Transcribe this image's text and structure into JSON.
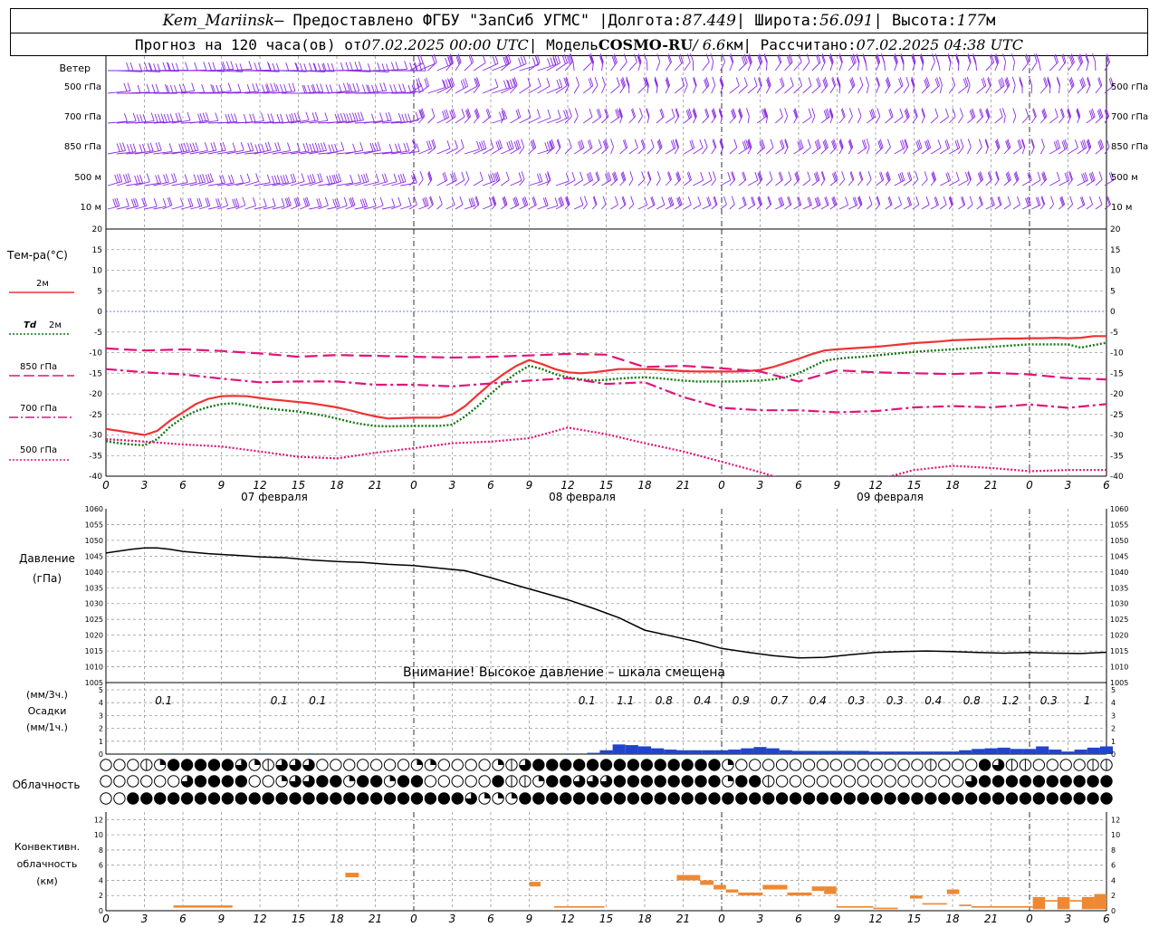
{
  "header": {
    "station": "Kem_Mariinsk",
    "provided_by": " — Предоставлено ФГБУ \"ЗапСиб УГМС\" | ",
    "lon_label": "Долгота: ",
    "lon": "87.449",
    "lat_label": " | Широта: ",
    "lat": "56.091",
    "alt_label": " | Высота: ",
    "alt": "177",
    "alt_unit": "м",
    "forecast_prefix": "Прогноз на 120 часа(ов) от ",
    "forecast_start": "07.02.2025 00:00 UTC",
    "model_label": " | Модель ",
    "model": "COSMO-RU",
    "model_res": " / 6.6",
    "model_res_unit": "км",
    "calc_label": " | Рассчитано: ",
    "calc_time": "07.02.2025 04:38 UTC"
  },
  "labels": {
    "wind": "Ветер",
    "level_500hpa": "500 гПа",
    "level_700hpa": "700 гПа",
    "level_850hpa": "850 гПа",
    "level_500m": "500 м",
    "level_10m": "10 м",
    "temp_title": "Тем-ра(°С)",
    "legend_2m": "2м",
    "legend_td": "Td",
    "legend_td_2m": "2м",
    "legend_850": "850 гПа",
    "legend_700": "700 гПа",
    "legend_500": "500 гПа",
    "pressure_title": "Давление",
    "pressure_unit": "(гПа)",
    "pressure_warning": "Внимание! Высокое давление – шкала смещена",
    "precip_unit3": "(мм/3ч.)",
    "precip_title": "Осадки",
    "precip_unit1": "(мм/1ч.)",
    "cloud_title": "Облачность",
    "conv_title1": "Конвективн.",
    "conv_title2": "облачность",
    "conv_unit": "(км)"
  },
  "colors": {
    "wind": "#8a2be2",
    "t2m": "#ee3333",
    "td2m": "#117711",
    "levels": "#e0157a",
    "zero_line": "#3355ff",
    "precip": "#2244cc",
    "conv": "#ee8833",
    "grid": "#999999"
  },
  "chart_data": [
    {
      "type": "line",
      "name": "temperature",
      "x_hours": [
        0,
        3,
        6,
        9,
        12,
        15,
        18,
        21,
        24,
        27,
        30,
        33,
        36,
        39,
        42,
        45,
        48,
        51,
        54,
        57,
        60,
        63,
        66,
        69,
        72,
        75,
        78
      ],
      "x_tick_labels": [
        "0",
        "3",
        "6",
        "9",
        "12",
        "15",
        "18",
        "21",
        "0",
        "3",
        "6",
        "9",
        "12",
        "15",
        "18",
        "21",
        "0",
        "3",
        "6",
        "9",
        "12",
        "15",
        "18",
        "21",
        "0",
        "3",
        "6"
      ],
      "day_labels": [
        "07 февраля",
        "08 февраля",
        "09 февраля"
      ],
      "ylim": [
        -40,
        20
      ],
      "yticks": [
        20,
        15,
        10,
        5,
        0,
        -5,
        -10,
        -15,
        -20,
        -25,
        -30,
        -35,
        -40
      ],
      "series": [
        {
          "key": "t2m",
          "x": [
            0,
            2,
            3,
            4,
            5,
            6,
            7,
            8,
            9,
            10,
            11,
            12,
            13,
            14,
            15,
            16,
            17,
            18,
            19,
            20,
            21,
            22,
            24,
            26,
            27,
            28,
            29,
            30,
            31,
            32,
            33,
            34,
            35,
            36,
            37,
            38,
            39,
            40,
            41,
            42,
            43,
            44,
            45,
            46,
            47,
            48,
            49,
            50,
            51,
            52,
            53,
            54,
            55,
            56,
            57,
            58,
            59,
            60,
            61,
            62,
            63,
            64,
            65,
            66,
            67,
            68,
            69,
            70,
            71,
            72,
            73,
            74,
            75,
            76,
            77,
            78
          ],
          "y": [
            -28.5,
            -29.5,
            -30,
            -29,
            -26.5,
            -24.5,
            -22.5,
            -21.2,
            -20.6,
            -20.5,
            -20.6,
            -21,
            -21.4,
            -21.7,
            -22,
            -22.3,
            -22.8,
            -23.3,
            -24,
            -24.8,
            -25.5,
            -26,
            -25.8,
            -25.8,
            -25,
            -23,
            -20.2,
            -17.5,
            -15.2,
            -13.2,
            -11.8,
            -12.8,
            -14,
            -14.8,
            -15,
            -14.8,
            -14.4,
            -14,
            -14,
            -14,
            -14.1,
            -14.3,
            -14.5,
            -14.6,
            -14.6,
            -14.6,
            -14.6,
            -14.5,
            -14.2,
            -13.5,
            -12.5,
            -11.5,
            -10.4,
            -9.5,
            -9.2,
            -9,
            -8.8,
            -8.6,
            -8.3,
            -8,
            -7.7,
            -7.5,
            -7.3,
            -7,
            -6.9,
            -6.8,
            -6.7,
            -6.6,
            -6.6,
            -6.5,
            -6.5,
            -6.4,
            -6.5,
            -6.4,
            -6,
            -6
          ]
        },
        {
          "key": "td2m",
          "x": [
            0,
            1,
            2,
            3,
            4,
            5,
            6,
            7,
            8,
            9,
            10,
            11,
            12,
            13,
            14,
            15,
            16,
            17,
            18,
            19,
            20,
            21,
            22,
            24,
            26,
            27,
            28,
            29,
            30,
            31,
            32,
            33,
            34,
            35,
            36,
            37,
            38,
            39,
            40,
            41,
            42,
            43,
            44,
            45,
            46,
            47,
            48,
            49,
            50,
            51,
            52,
            53,
            54,
            55,
            56,
            57,
            58,
            59,
            60,
            61,
            62,
            63,
            64,
            65,
            66,
            67,
            68,
            69,
            70,
            71,
            72,
            73,
            74,
            75,
            76,
            77,
            78
          ],
          "y": [
            -31.5,
            -32,
            -32.3,
            -32.5,
            -31,
            -28,
            -25.8,
            -24.2,
            -23.2,
            -22.5,
            -22.3,
            -22.8,
            -23.3,
            -23.7,
            -24,
            -24.3,
            -24.8,
            -25.3,
            -26,
            -26.8,
            -27.4,
            -27.8,
            -27.9,
            -27.8,
            -27.8,
            -27.5,
            -25.5,
            -23,
            -20,
            -17.3,
            -15,
            -13.2,
            -14,
            -15.2,
            -16,
            -16.5,
            -16.8,
            -16.6,
            -16.3,
            -16.1,
            -16,
            -16.2,
            -16.5,
            -16.8,
            -17,
            -17,
            -17,
            -17,
            -16.9,
            -16.8,
            -16.5,
            -16,
            -15,
            -13.5,
            -12,
            -11.5,
            -11.2,
            -11,
            -10.7,
            -10.4,
            -10.1,
            -9.8,
            -9.6,
            -9.4,
            -9.2,
            -9,
            -8.8,
            -8.6,
            -8.4,
            -8.2,
            -8,
            -8,
            -8,
            -8,
            -8.8,
            -8.2,
            -7.6
          ]
        },
        {
          "key": "t850",
          "x": [
            0,
            3,
            6,
            9,
            12,
            15,
            18,
            21,
            24,
            27,
            30,
            33,
            36,
            39,
            42,
            45,
            48,
            51,
            54,
            57,
            60,
            63,
            66,
            69,
            72,
            75,
            78
          ],
          "y": [
            -9,
            -9.5,
            -9.2,
            -9.6,
            -10.2,
            -11,
            -10.6,
            -10.8,
            -11,
            -11.2,
            -11,
            -10.7,
            -10.3,
            -10.5,
            -13.5,
            -13.2,
            -13.8,
            -14.6,
            -17,
            -14.3,
            -14.8,
            -15,
            -15.2,
            -14.9,
            -15.3,
            -16.2,
            -16.5
          ]
        },
        {
          "key": "t700",
          "x": [
            0,
            3,
            6,
            9,
            12,
            15,
            18,
            21,
            24,
            27,
            30,
            33,
            36,
            39,
            42,
            45,
            48,
            51,
            54,
            57,
            60,
            63,
            66,
            69,
            72,
            75,
            78
          ],
          "y": [
            -14,
            -14.8,
            -15.3,
            -16.3,
            -17.2,
            -17,
            -17,
            -17.8,
            -17.8,
            -18.2,
            -17.5,
            -16.8,
            -16.2,
            -17.6,
            -17.2,
            -20.8,
            -23.4,
            -24,
            -24,
            -24.5,
            -24.2,
            -23.3,
            -23,
            -23.3,
            -22.6,
            -23.4,
            -22.5
          ]
        },
        {
          "key": "t500",
          "x": [
            0,
            3,
            6,
            9,
            12,
            15,
            18,
            21,
            24,
            27,
            30,
            33,
            36,
            39,
            42,
            45,
            48,
            51,
            54,
            57,
            60,
            63,
            66,
            69,
            72,
            75,
            78
          ],
          "y": [
            -31,
            -31.6,
            -32.3,
            -32.8,
            -34,
            -35.3,
            -35.7,
            -34.3,
            -33.2,
            -32,
            -31.6,
            -30.8,
            -28.2,
            -29.8,
            -32,
            -34,
            -36.5,
            -39,
            -42,
            -44,
            -41,
            -38.5,
            -37.5,
            -38,
            -38.8,
            -38.5,
            -38.5
          ]
        }
      ]
    },
    {
      "type": "line",
      "name": "pressure",
      "ylim": [
        1005,
        1060
      ],
      "yticks": [
        1060,
        1055,
        1050,
        1045,
        1040,
        1035,
        1030,
        1025,
        1020,
        1015,
        1010,
        1005
      ],
      "x": [
        0,
        2,
        3,
        4,
        5,
        6,
        8,
        10,
        12,
        14,
        16,
        18,
        20,
        22,
        24,
        26,
        28,
        30,
        32,
        34,
        36,
        38,
        40,
        42,
        44,
        46,
        48,
        50,
        52,
        54,
        56,
        58,
        60,
        62,
        64,
        66,
        68,
        70,
        72,
        74,
        76,
        78
      ],
      "y": [
        1046,
        1047.2,
        1047.6,
        1047.6,
        1047.2,
        1046.5,
        1045.8,
        1045.3,
        1044.8,
        1044.5,
        1043.8,
        1043.3,
        1043,
        1042.4,
        1042,
        1041.2,
        1040.4,
        1038.2,
        1035.8,
        1033.5,
        1031.2,
        1028.5,
        1025.5,
        1021.6,
        1019.8,
        1018,
        1015.8,
        1014.6,
        1013.5,
        1012.8,
        1013,
        1013.8,
        1014.5,
        1014.8,
        1015,
        1014.8,
        1014.5,
        1014.3,
        1014.5,
        1014.3,
        1014.2,
        1014.6
      ]
    },
    {
      "type": "bar",
      "name": "precipitation",
      "ylim": [
        0,
        5
      ],
      "yticks": [
        5,
        4,
        3,
        2,
        1,
        0
      ],
      "hourly_x": [
        5,
        12,
        16,
        36,
        38,
        39,
        40,
        41,
        42,
        43,
        44,
        45,
        46,
        47,
        48,
        49,
        50,
        51,
        52,
        53,
        54,
        55,
        56,
        57,
        58,
        59,
        60,
        61,
        62,
        63,
        64,
        65,
        66,
        67,
        68,
        69,
        70,
        71,
        72,
        73,
        74,
        75,
        76,
        77,
        78
      ],
      "hourly_mm": [
        0.05,
        0.05,
        0.05,
        0.05,
        0.1,
        0.3,
        0.75,
        0.7,
        0.6,
        0.45,
        0.35,
        0.3,
        0.3,
        0.3,
        0.3,
        0.35,
        0.45,
        0.55,
        0.45,
        0.3,
        0.25,
        0.25,
        0.25,
        0.25,
        0.25,
        0.25,
        0.2,
        0.2,
        0.2,
        0.2,
        0.2,
        0.2,
        0.2,
        0.3,
        0.4,
        0.45,
        0.5,
        0.4,
        0.4,
        0.6,
        0.35,
        0.2,
        0.35,
        0.5,
        0.6
      ],
      "accum3h_x": [
        4.5,
        13.5,
        16.5,
        37.5,
        40.5,
        43.5,
        46.5,
        49.5,
        52.5,
        55.5,
        58.5,
        61.5,
        64.5,
        67.5,
        70.5,
        73.5,
        76.5
      ],
      "accum3h_labels": [
        "0.1",
        "0.1",
        "0.1",
        "0.1",
        "1.1",
        "0.8",
        "0.4",
        "0.9",
        "0.7",
        "0.4",
        "0.3",
        "0.3",
        "0.4",
        "0.8",
        "1.2",
        "0.3",
        "1"
      ]
    },
    {
      "type": "table",
      "name": "cloudiness",
      "rows": [
        "000124444432133300000002200002134444444444444420000000000000010004311000011",
        "000000344440023344244244000004112443334444444424410000000000000034444444444",
        "004444444444444444444444444322244444444444444444444444444444444444444444444"
      ]
    },
    {
      "type": "bar",
      "name": "convective_cloud",
      "ylim": [
        0,
        13
      ],
      "yticks": [
        12,
        10,
        8,
        6,
        4,
        2,
        0
      ],
      "segments": [
        {
          "x0": 5.5,
          "x1": 10.3,
          "lo": 0.4,
          "hi": 0.7
        },
        {
          "x0": 19.5,
          "x1": 20.6,
          "lo": 4.4,
          "hi": 5.0
        },
        {
          "x0": 34.5,
          "x1": 35.4,
          "lo": 3.2,
          "hi": 3.8
        },
        {
          "x0": 36.5,
          "x1": 40.6,
          "lo": 0.4,
          "hi": 0.6
        },
        {
          "x0": 46.5,
          "x1": 48.4,
          "lo": 4.0,
          "hi": 4.7
        },
        {
          "x0": 48.4,
          "x1": 49.5,
          "lo": 3.4,
          "hi": 4.0
        },
        {
          "x0": 49.5,
          "x1": 50.5,
          "lo": 2.8,
          "hi": 3.4
        },
        {
          "x0": 50.5,
          "x1": 51.5,
          "lo": 2.4,
          "hi": 2.8
        },
        {
          "x0": 51.5,
          "x1": 53.5,
          "lo": 2.0,
          "hi": 2.4
        },
        {
          "x0": 53.5,
          "x1": 55.5,
          "lo": 2.8,
          "hi": 3.4
        },
        {
          "x0": 55.5,
          "x1": 57.5,
          "lo": 2.0,
          "hi": 2.4
        },
        {
          "x0": 57.5,
          "x1": 58.5,
          "lo": 2.6,
          "hi": 3.2
        },
        {
          "x0": 58.5,
          "x1": 59.5,
          "lo": 2.2,
          "hi": 3.2
        },
        {
          "x0": 59.5,
          "x1": 62.5,
          "lo": 0.4,
          "hi": 0.6
        },
        {
          "x0": 62.5,
          "x1": 64.5,
          "lo": 0.2,
          "hi": 0.4
        },
        {
          "x0": 65.5,
          "x1": 66.5,
          "lo": 1.6,
          "hi": 2.0
        },
        {
          "x0": 66.5,
          "x1": 68.5,
          "lo": 0.8,
          "hi": 1.0
        },
        {
          "x0": 68.5,
          "x1": 69.5,
          "lo": 2.2,
          "hi": 2.8
        },
        {
          "x0": 69.5,
          "x1": 70.5,
          "lo": 0.6,
          "hi": 0.8
        },
        {
          "x0": 70.5,
          "x1": 75.5,
          "lo": 0.4,
          "hi": 0.6
        },
        {
          "x0": 75.5,
          "x1": 76.5,
          "lo": 0.2,
          "hi": 1.8
        },
        {
          "x0": 76.5,
          "x1": 77.5,
          "lo": 1.2,
          "hi": 1.4
        },
        {
          "x0": 77.5,
          "x1": 78.5,
          "lo": 0.2,
          "hi": 1.8
        },
        {
          "x0": 78.5,
          "x1": 79.5,
          "lo": 1.2,
          "hi": 1.4
        },
        {
          "x0": 79.5,
          "x1": 80.5,
          "lo": 0.2,
          "hi": 1.8
        },
        {
          "x0": 80.5,
          "x1": 81.5,
          "lo": 0.2,
          "hi": 2.2
        }
      ]
    }
  ]
}
